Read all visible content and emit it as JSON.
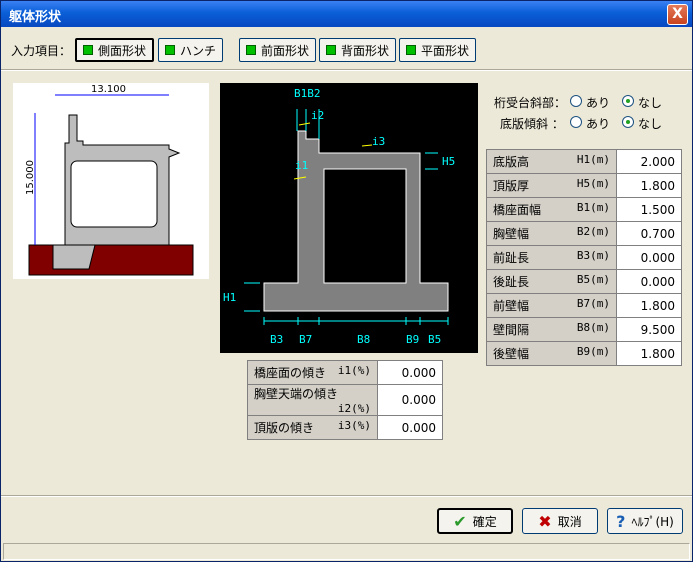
{
  "window": {
    "title": "躯体形状",
    "close_label": "X"
  },
  "input_bar": {
    "label": "入力項目：",
    "tabs": [
      {
        "label": "側面形状",
        "active": true
      },
      {
        "label": "ハンチ",
        "active": false
      },
      {
        "label": "前面形状",
        "active": false
      },
      {
        "label": "背面形状",
        "active": false
      },
      {
        "label": "平面形状",
        "active": false
      }
    ]
  },
  "thumbnail": {
    "width_label": "13.100",
    "height_label": "15.000"
  },
  "diagram": {
    "labels": {
      "b1b2": "B1B2",
      "i2": "i2",
      "i3": "i3",
      "h5": "H5",
      "i1": "i1",
      "h1": "H1",
      "b3": "B3",
      "b7": "B7",
      "b8": "B8",
      "b9": "B9",
      "b5": "B5"
    }
  },
  "options": {
    "row1": {
      "label": "桁受台斜部：",
      "opt1": "あり",
      "opt2": "なし",
      "selected": "なし"
    },
    "row2": {
      "label": "底版傾斜 ：",
      "opt1": "あり",
      "opt2": "なし",
      "selected": "なし"
    }
  },
  "dimensions": [
    {
      "name": "底版高",
      "unit": "H1(m)",
      "value": "2.000"
    },
    {
      "name": "頂版厚",
      "unit": "H5(m)",
      "value": "1.800"
    },
    {
      "name": "橋座面幅",
      "unit": "B1(m)",
      "value": "1.500"
    },
    {
      "name": "胸壁幅",
      "unit": "B2(m)",
      "value": "0.700"
    },
    {
      "name": "前趾長",
      "unit": "B3(m)",
      "value": "0.000"
    },
    {
      "name": "後趾長",
      "unit": "B5(m)",
      "value": "0.000"
    },
    {
      "name": "前壁幅",
      "unit": "B7(m)",
      "value": "1.800"
    },
    {
      "name": "壁間隔",
      "unit": "B8(m)",
      "value": "9.500"
    },
    {
      "name": "後壁幅",
      "unit": "B9(m)",
      "value": "1.800"
    }
  ],
  "slopes": [
    {
      "name": "橋座面の傾き",
      "unit": "i1(%)",
      "value": "0.000"
    },
    {
      "name": "胸壁天端の傾き",
      "unit": "i2(%)",
      "value": "0.000"
    },
    {
      "name": "頂版の傾き",
      "unit": "i3(%)",
      "value": "0.000"
    }
  ],
  "buttons": {
    "ok": "確定",
    "cancel": "取消",
    "help": "ﾍﾙﾌﾟ(H)"
  },
  "colors": {
    "accent": "#0a5fd8",
    "tab_marker": "#00c000",
    "structure": "#808080",
    "ground": "#800000"
  }
}
